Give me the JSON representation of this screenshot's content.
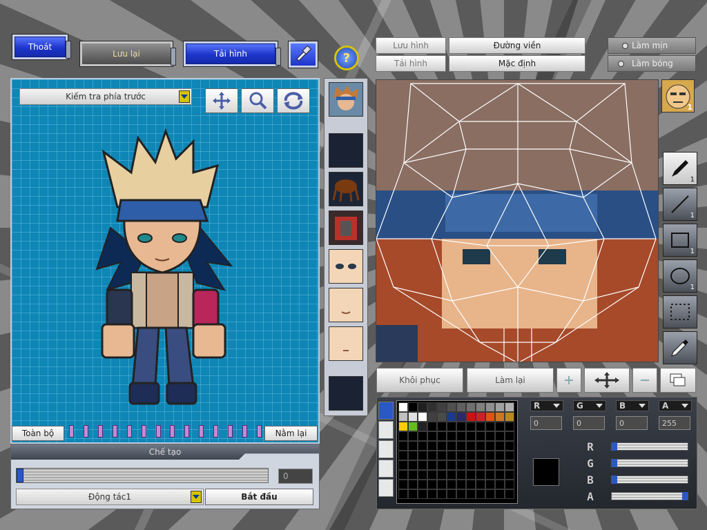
{
  "toolbar": {
    "exit_label": "Thoát",
    "save_label": "Lưu lại",
    "reload_label": "Tải hình"
  },
  "help": {
    "icon": "question-icon"
  },
  "preview": {
    "view_select": "Kiếm tra phía trước",
    "tools": [
      "move-icon",
      "magnifier-icon",
      "rotate-icon"
    ],
    "all_label": "Toàn bộ",
    "lie_down_label": "Nằm lại",
    "frame_ticks": 14
  },
  "create": {
    "title": "Chế tạo",
    "frame_value": "0",
    "slider_level": 0,
    "action_select": "Động tác1",
    "start_label": "Bắt đầu"
  },
  "editor": {
    "save_image_label": "Lưu hình",
    "load_image_label": "Tải hình",
    "border_label": "Đường viền",
    "default_label": "Mặc định",
    "smooth_label": "Làm mịn",
    "shade_label": "Làm bóng",
    "restore_label": "Khôi phục",
    "redo_label": "Làm lại",
    "tool_counts": [
      "1",
      "1",
      "1",
      "1"
    ],
    "avatar_badge": "1"
  },
  "color": {
    "channels": [
      {
        "name": "R",
        "value": "0"
      },
      {
        "name": "G",
        "value": "0"
      },
      {
        "name": "B",
        "value": "0"
      },
      {
        "name": "A",
        "value": "255"
      }
    ],
    "slider_labels": [
      "R",
      "G",
      "B",
      "A"
    ],
    "slider_levels": [
      0,
      0,
      0,
      1
    ],
    "current": "#000000",
    "palette_row0": [
      "#ffffff",
      "#000000",
      "#202020",
      "#303030",
      "#404040",
      "#505050",
      "#606060",
      "#707070",
      "#808080",
      "#909090",
      "#a0a0a0",
      "#b0b0b0"
    ],
    "palette_row1": [
      "#c0c0c0",
      "#e0e0e0",
      "#ffffff",
      "#404040",
      "#4a4a4a",
      "#1a3a8a",
      "#2a2a6a",
      "#cc1111",
      "#cc2222",
      "#dd5511",
      "#cc7722",
      "#bb8822"
    ],
    "palette_row2": [
      "#ffcc00",
      "#66bb22",
      "#222222"
    ]
  }
}
